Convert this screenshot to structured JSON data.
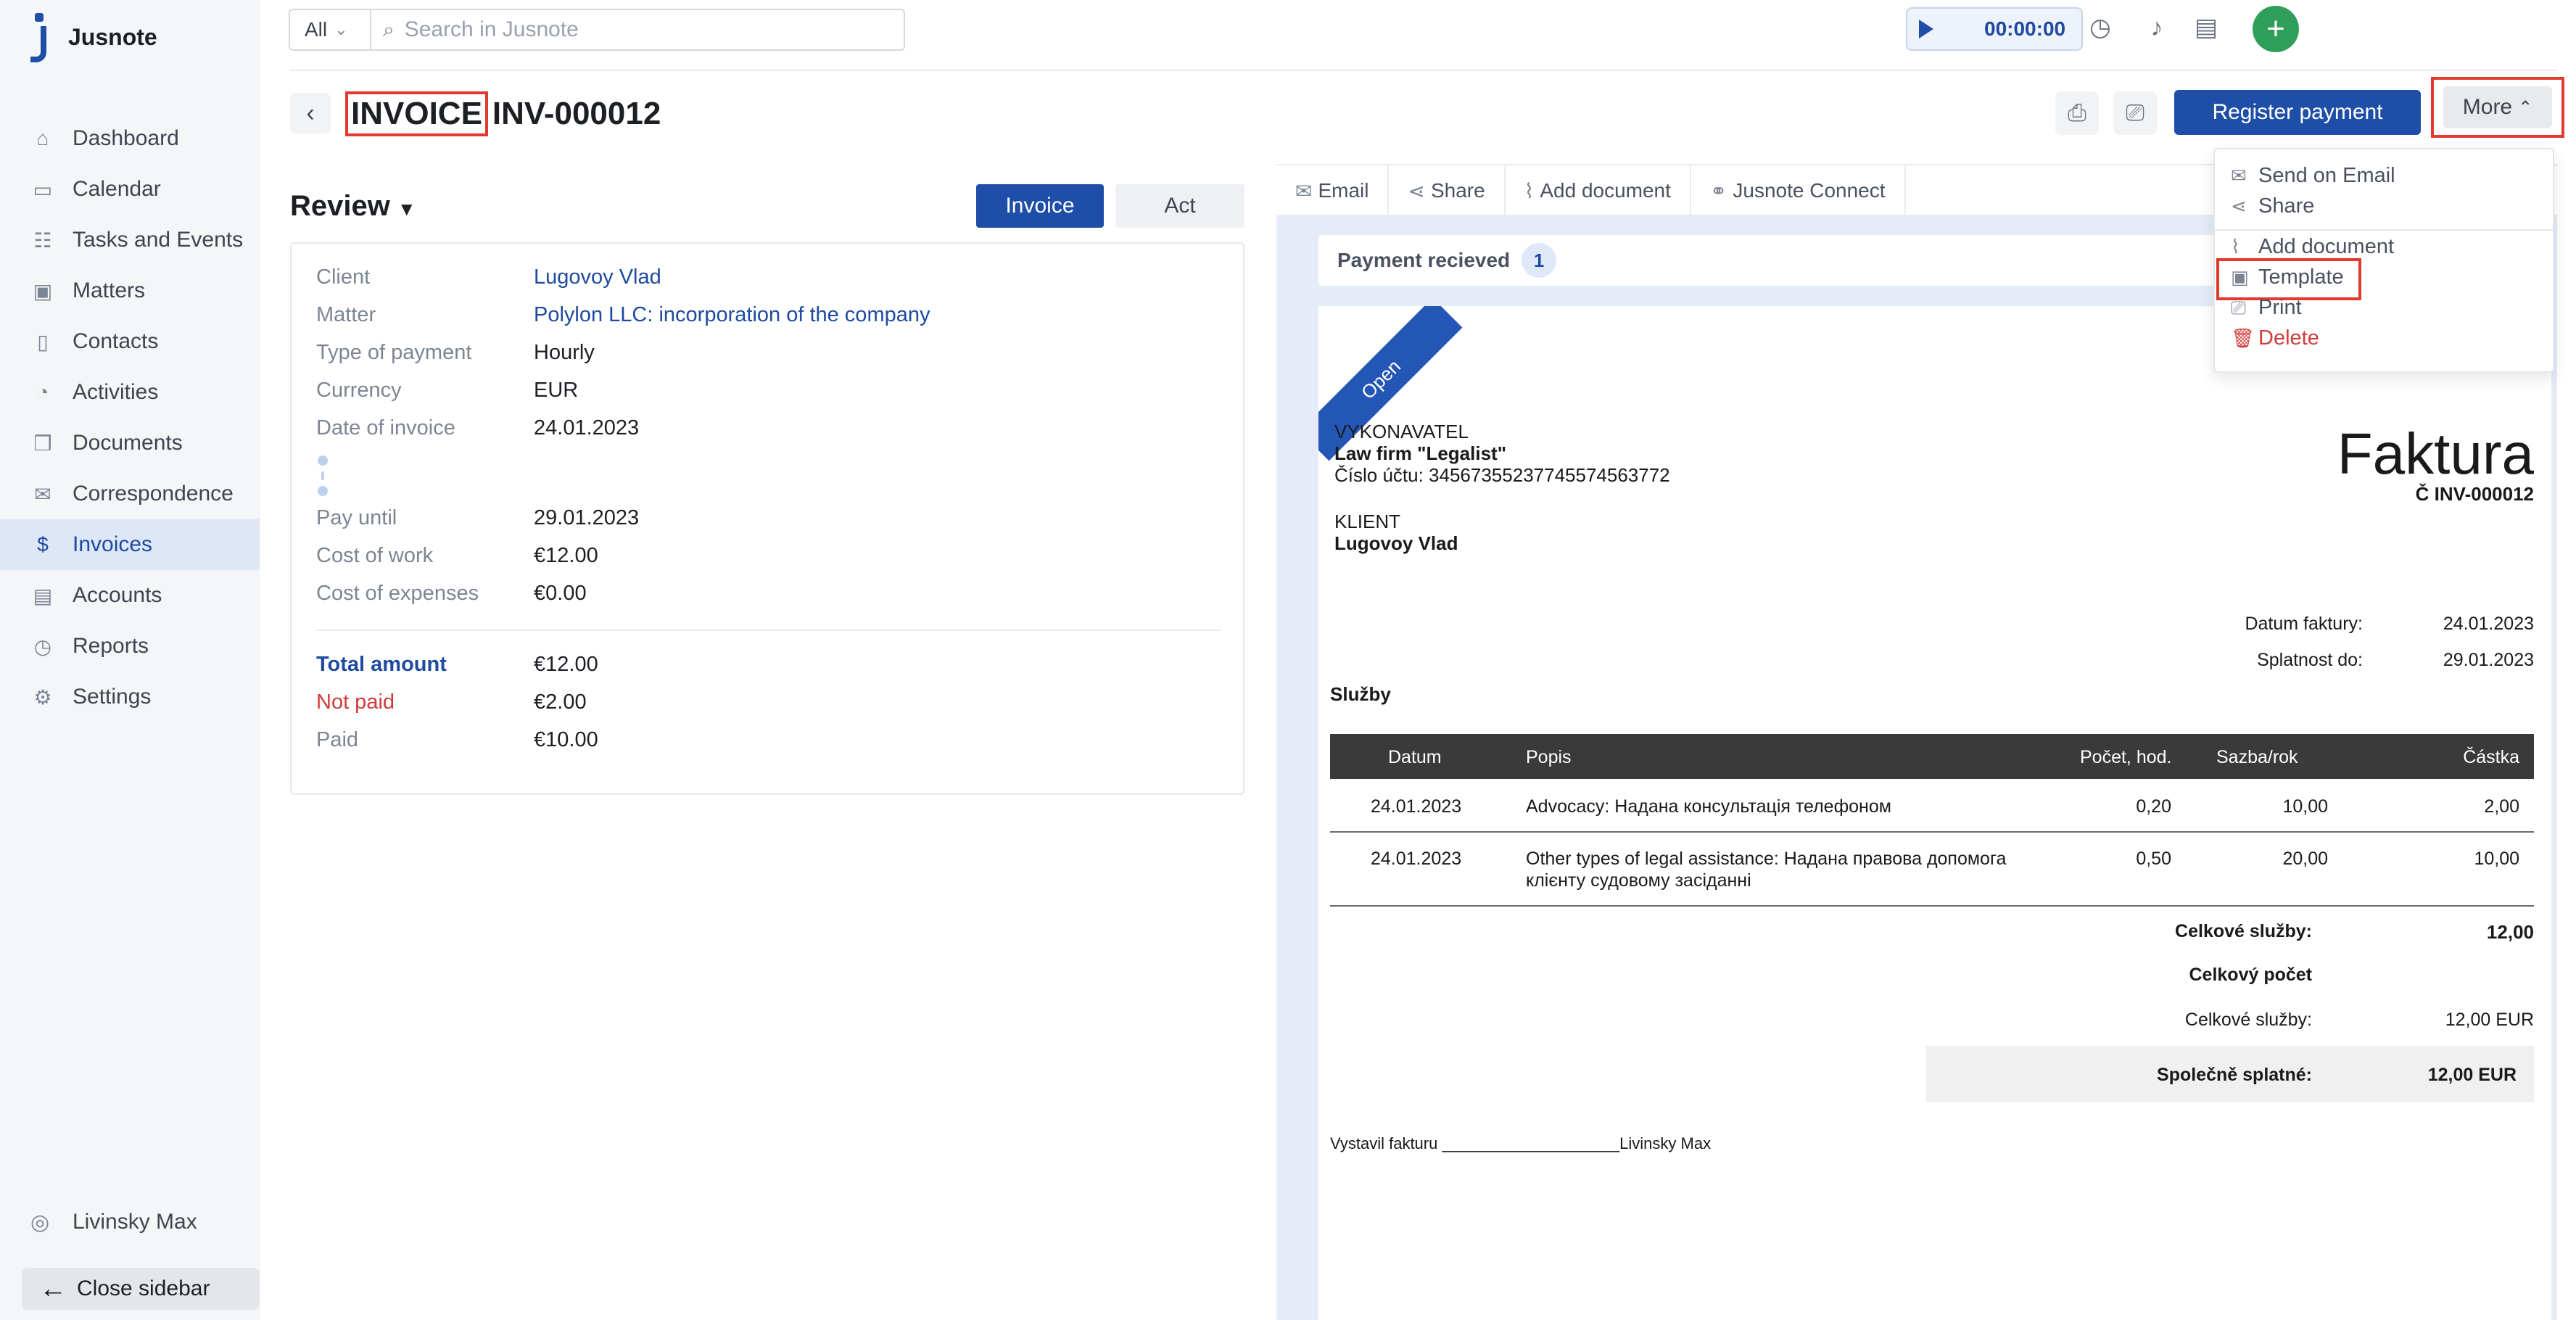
{
  "app": {
    "name": "Jusnote"
  },
  "sidebar": {
    "items": [
      {
        "label": "Dashboard",
        "icon": "home-icon"
      },
      {
        "label": "Calendar",
        "icon": "calendar-icon"
      },
      {
        "label": "Tasks and Events",
        "icon": "tasks-icon"
      },
      {
        "label": "Matters",
        "icon": "briefcase-icon"
      },
      {
        "label": "Contacts",
        "icon": "contacts-icon"
      },
      {
        "label": "Activities",
        "icon": "activities-icon"
      },
      {
        "label": "Documents",
        "icon": "documents-icon"
      },
      {
        "label": "Correspondence",
        "icon": "correspondence-icon"
      },
      {
        "label": "Invoices",
        "icon": "invoice-icon",
        "active": true
      },
      {
        "label": "Accounts",
        "icon": "accounts-icon"
      },
      {
        "label": "Reports",
        "icon": "reports-icon"
      },
      {
        "label": "Settings",
        "icon": "gear-icon"
      }
    ],
    "user": "Livinsky Max",
    "close_label": "Close sidebar"
  },
  "topbar": {
    "scope": "All",
    "search_placeholder": "Search in Jusnote",
    "timer": "00:00:00"
  },
  "header": {
    "doc_type": "INVOICE",
    "number": "INV-000012",
    "register_label": "Register payment",
    "more_label": "More"
  },
  "review": {
    "title": "Review",
    "toggle_invoice": "Invoice",
    "toggle_act": "Act",
    "fields": {
      "client": {
        "label": "Client",
        "value": "Lugovoy Vlad"
      },
      "matter": {
        "label": "Matter",
        "value": "Polylon LLC: incorporation of the company"
      },
      "payment_type": {
        "label": "Type of payment",
        "value": "Hourly"
      },
      "currency": {
        "label": "Currency",
        "value": "EUR"
      },
      "date": {
        "label": "Date of invoice",
        "value": "24.01.2023"
      },
      "pay_until": {
        "label": "Pay until",
        "value": "29.01.2023"
      },
      "cost_work": {
        "label": "Cost of work",
        "value": "€12.00"
      },
      "cost_expenses": {
        "label": "Cost of expenses",
        "value": "€0.00"
      },
      "total": {
        "label": "Total amount",
        "value": "€12.00"
      },
      "not_paid": {
        "label": "Not paid",
        "value": "€2.00"
      },
      "paid": {
        "label": "Paid",
        "value": "€10.00"
      }
    }
  },
  "tabs": [
    "Email",
    "Share",
    "Add document",
    "Jusnote Connect"
  ],
  "payment": {
    "label": "Payment recieved",
    "count": "1"
  },
  "document": {
    "ribbon": "Open",
    "executor_label": "VYKONAVATEL",
    "firm": "Law firm \"Legalist\"",
    "account": "Číslo účtu: 3456735523774557456377​2",
    "client_label": "KLIENT",
    "client": "Lugovoy Vlad",
    "heading": "Faktura",
    "number": "Č INV-000012",
    "date_label": "Datum faktury:",
    "date": "24.01.2023",
    "due_label": "Splatnost do:",
    "due": "29.01.2023",
    "services_label": "Služby",
    "columns": [
      "Datum",
      "Popis",
      "Počet, hod.",
      "Sazba/rok",
      "Částka"
    ],
    "rows": [
      {
        "date": "24.01.2023",
        "desc1": "Advocacy: Надана консультація телефоном",
        "desc2": "",
        "qty": "0,20",
        "rate": "10,00",
        "amount": "2,00"
      },
      {
        "date": "24.01.2023",
        "desc1": "Other types of legal assistance: Надана правова допомога",
        "desc2": "клієнту судовому засіданні",
        "qty": "0,50",
        "rate": "20,00",
        "amount": "10,00"
      }
    ],
    "total_services_label": "Celkové služby:",
    "total_services": "12,00",
    "total_count_label": "Celkový počet",
    "total_services_label2": "Celkové služby:",
    "total_services_eur": "12,00 EUR",
    "grand_label": "Společně splatné:",
    "grand": "12,00 EUR",
    "issued_label": "Vystavil fakturu ____________________",
    "issued_by": "Livinsky Max"
  },
  "menu": {
    "items": [
      "Send on Email",
      "Share",
      "Add document",
      "Template",
      "Print",
      "Delete"
    ]
  },
  "colors": {
    "accent": "#1f4ea8",
    "highlight": "#e33a2f",
    "danger": "#d23a3a"
  }
}
